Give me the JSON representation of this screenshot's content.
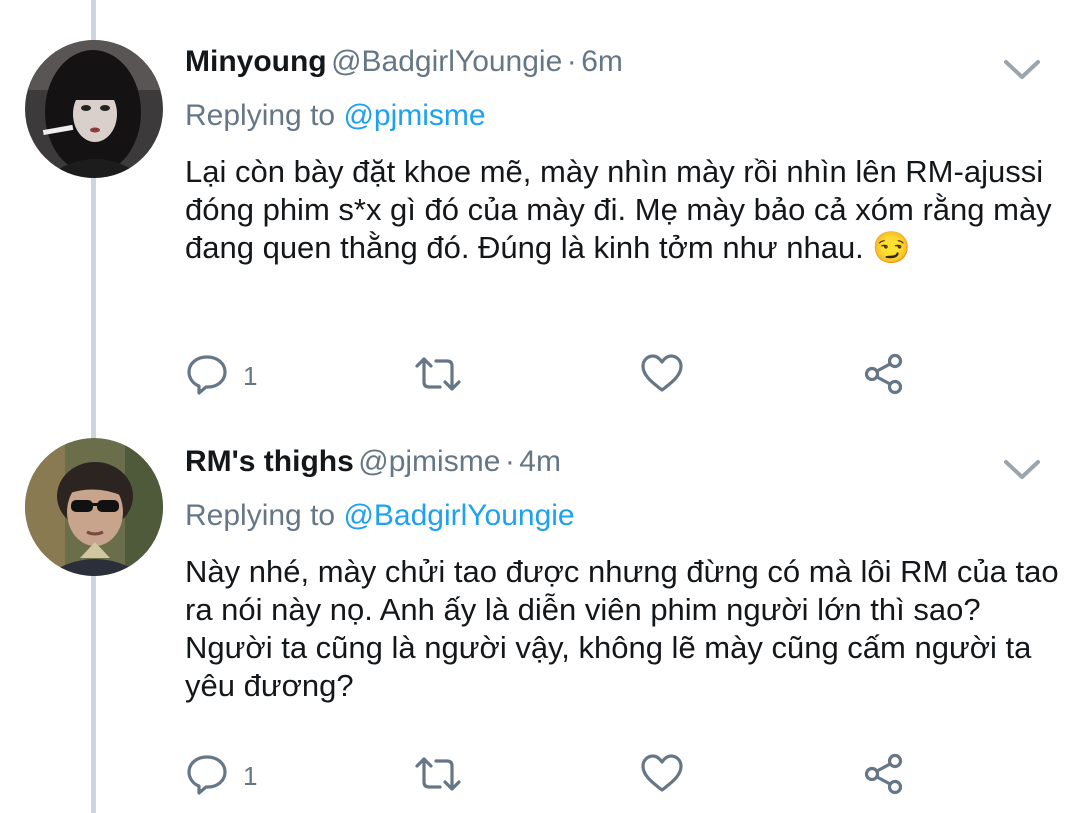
{
  "tweets": [
    {
      "name": "Minyoung",
      "handle": "@BadgirlYoungie",
      "separator": "·",
      "time": "6m",
      "replying_prefix": "Replying to",
      "replying_to": "@pjmisme",
      "text": "Lại còn bày đặt khoe mẽ, mày nhìn mày rồi nhìn lên RM-ajussi đóng phim s*x gì đó của mày đi. Mẹ mày bảo cả xóm rằng mày đang quen thằng đó. Đúng là kinh tởm như nhau.",
      "emoji": "😏",
      "reply_count": "1",
      "avatar_icon": "avatar-photo-girl"
    },
    {
      "name": "RM's thighs",
      "handle": "@pjmisme",
      "separator": "·",
      "time": "4m",
      "replying_prefix": "Replying to",
      "replying_to": "@BadgirlYoungie",
      "text": "Này nhé, mày chửi tao được nhưng đừng có mà lôi RM của tao ra nói này nọ. Anh ấy là diễn viên phim người lớn thì sao? Người ta cũng là người vậy, không lẽ mày cũng cấm người ta yêu đương?",
      "emoji": "",
      "reply_count": "1",
      "avatar_icon": "avatar-photo-man-sunglasses"
    }
  ],
  "colors": {
    "text": "#14171a",
    "secondary": "#657786",
    "link": "#1da1f2",
    "thread_line": "#ccd6dd"
  },
  "icons": [
    "reply-icon",
    "retweet-icon",
    "like-icon",
    "share-icon",
    "chevron-down-icon"
  ]
}
